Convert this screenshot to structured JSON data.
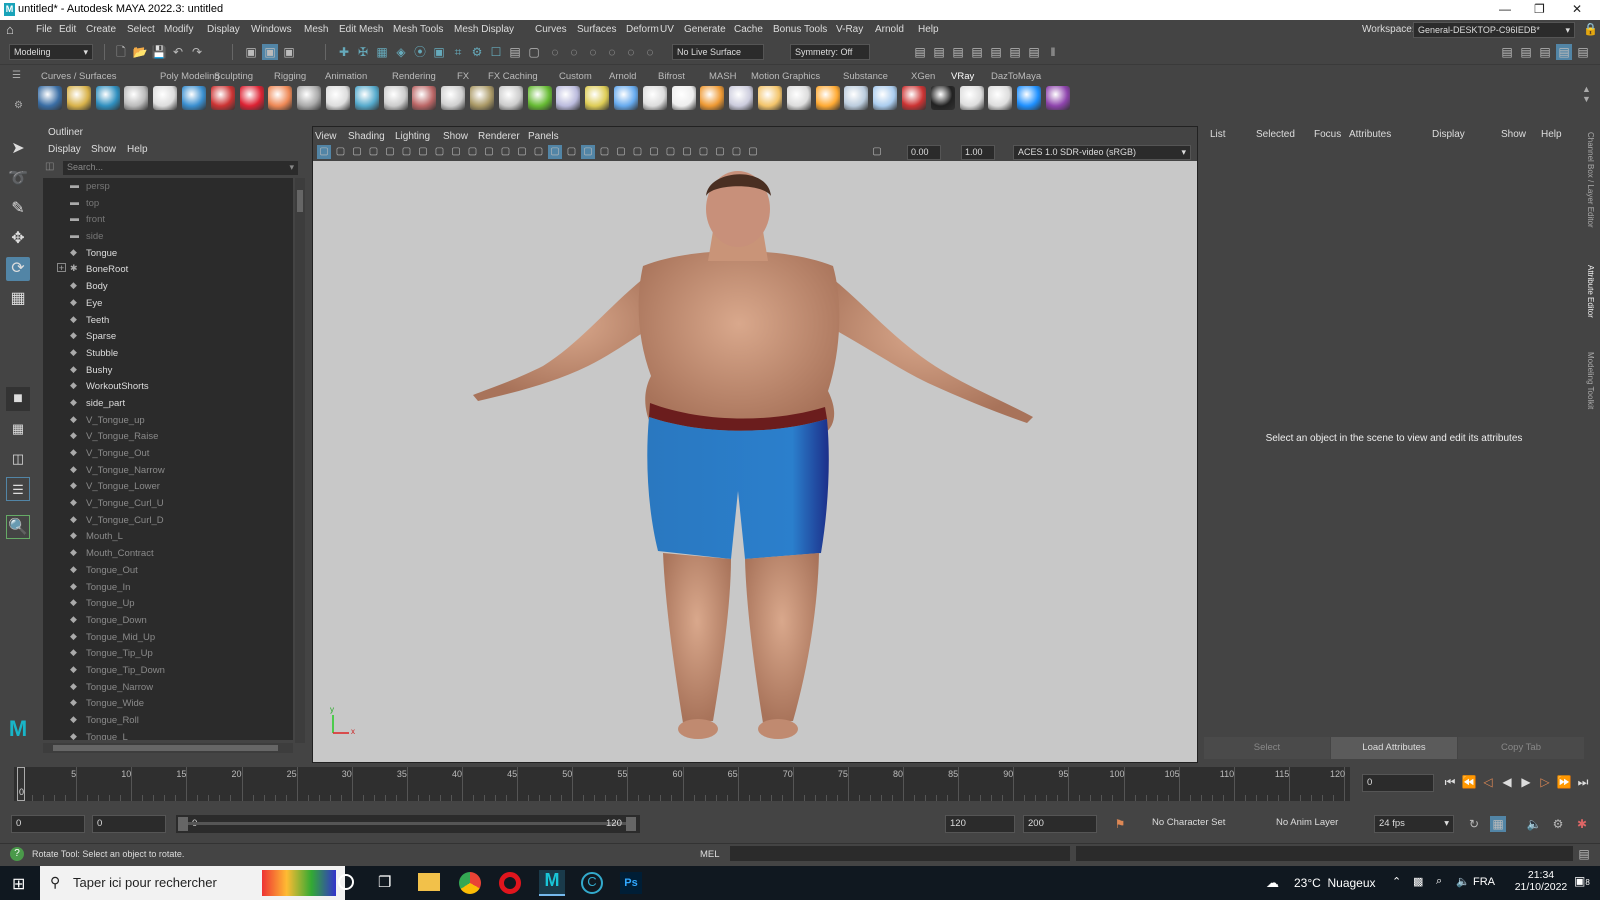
{
  "window": {
    "title": "untitled* - Autodesk MAYA 2022.3: untitled",
    "app_icon": "M"
  },
  "menubar": [
    "File",
    "Edit",
    "Create",
    "Select",
    "Modify",
    "Display",
    "Windows",
    "Mesh",
    "Edit Mesh",
    "Mesh Tools",
    "Mesh Display",
    "Curves",
    "Surfaces",
    "Deform",
    "UV",
    "Generate",
    "Cache",
    "Bonus Tools",
    "V-Ray",
    "Arnold",
    "Help"
  ],
  "workspace": {
    "label": "Workspace:",
    "value": "General-DESKTOP-C96IEDB*"
  },
  "statusline": {
    "menuset": "Modeling",
    "live_surface": "No Live Surface",
    "symmetry": "Symmetry: Off"
  },
  "shelf_tabs": [
    "Curves / Surfaces",
    "Poly Modeling",
    "Sculpting",
    "Rigging",
    "Animation",
    "Rendering",
    "FX",
    "FX Caching",
    "Custom",
    "Arnold",
    "Bifrost",
    "MASH",
    "Motion Graphics",
    "Substance",
    "XGen",
    "VRay",
    "DazToMaya"
  ],
  "shelf_active": "VRay",
  "outliner": {
    "title": "Outliner",
    "menus": [
      "Display",
      "Show",
      "Help"
    ],
    "search_placeholder": "Search...",
    "items": [
      {
        "label": "persp",
        "type": "camera"
      },
      {
        "label": "top",
        "type": "camera"
      },
      {
        "label": "front",
        "type": "camera"
      },
      {
        "label": "side",
        "type": "camera"
      },
      {
        "label": "Tongue",
        "type": "mesh"
      },
      {
        "label": "BoneRoot",
        "type": "joint"
      },
      {
        "label": "Body",
        "type": "mesh"
      },
      {
        "label": "Eye",
        "type": "mesh"
      },
      {
        "label": "Teeth",
        "type": "mesh"
      },
      {
        "label": "Sparse",
        "type": "mesh"
      },
      {
        "label": "Stubble",
        "type": "mesh"
      },
      {
        "label": "Bushy",
        "type": "mesh"
      },
      {
        "label": "WorkoutShorts",
        "type": "mesh"
      },
      {
        "label": "side_part",
        "type": "mesh"
      },
      {
        "label": "V_Tongue_up",
        "type": "shape"
      },
      {
        "label": "V_Tongue_Raise",
        "type": "shape"
      },
      {
        "label": "V_Tongue_Out",
        "type": "shape"
      },
      {
        "label": "V_Tongue_Narrow",
        "type": "shape"
      },
      {
        "label": "V_Tongue_Lower",
        "type": "shape"
      },
      {
        "label": "V_Tongue_Curl_U",
        "type": "shape"
      },
      {
        "label": "V_Tongue_Curl_D",
        "type": "shape"
      },
      {
        "label": "Mouth_L",
        "type": "shape"
      },
      {
        "label": "Mouth_Contract",
        "type": "shape"
      },
      {
        "label": "Tongue_Out",
        "type": "shape"
      },
      {
        "label": "Tongue_In",
        "type": "shape"
      },
      {
        "label": "Tongue_Up",
        "type": "shape"
      },
      {
        "label": "Tongue_Down",
        "type": "shape"
      },
      {
        "label": "Tongue_Mid_Up",
        "type": "shape"
      },
      {
        "label": "Tongue_Tip_Up",
        "type": "shape"
      },
      {
        "label": "Tongue_Tip_Down",
        "type": "shape"
      },
      {
        "label": "Tongue_Narrow",
        "type": "shape"
      },
      {
        "label": "Tongue_Wide",
        "type": "shape"
      },
      {
        "label": "Tongue_Roll",
        "type": "shape"
      },
      {
        "label": "Tongue_L",
        "type": "shape"
      }
    ]
  },
  "viewport": {
    "menus": [
      "View",
      "Shading",
      "Lighting",
      "Show",
      "Renderer",
      "Panels"
    ],
    "exposure": "0.00",
    "gamma": "1.00",
    "colorspace": "ACES 1.0 SDR-video (sRGB)",
    "axis_y": "y",
    "axis_x": "x"
  },
  "attribute_editor": {
    "menus": [
      "List",
      "Selected",
      "Focus",
      "Attributes",
      "Display",
      "Show",
      "Help"
    ],
    "message": "Select an object in the scene to view and edit its attributes",
    "buttons": [
      "Select",
      "Load Attributes",
      "Copy Tab"
    ],
    "side_tabs": [
      "Channel Box / Layer Editor",
      "Attribute Editor",
      "Modeling Toolkit"
    ]
  },
  "timeline": {
    "ticks": [
      "0",
      "5",
      "10",
      "15",
      "20",
      "25",
      "30",
      "35",
      "40",
      "45",
      "50",
      "55",
      "60",
      "65",
      "70",
      "75",
      "80",
      "85",
      "90",
      "95",
      "100",
      "105",
      "110",
      "115",
      "120"
    ],
    "current_frame": "0"
  },
  "range": {
    "start": "0",
    "anim_start": "0",
    "slider_start": "0",
    "slider_end": "120",
    "anim_end": "120",
    "end": "200",
    "character_set": "No Character Set",
    "anim_layer": "No Anim Layer",
    "fps": "24 fps"
  },
  "helpline": {
    "text": "Rotate Tool: Select an object to rotate.",
    "lang": "MEL"
  },
  "taskbar": {
    "search": "Taper ici pour rechercher",
    "weather": "23°C  Nuageux",
    "lang": "FRA",
    "time": "21:34",
    "date": "21/10/2022",
    "notifications": "8",
    "ps_label": "Ps"
  }
}
